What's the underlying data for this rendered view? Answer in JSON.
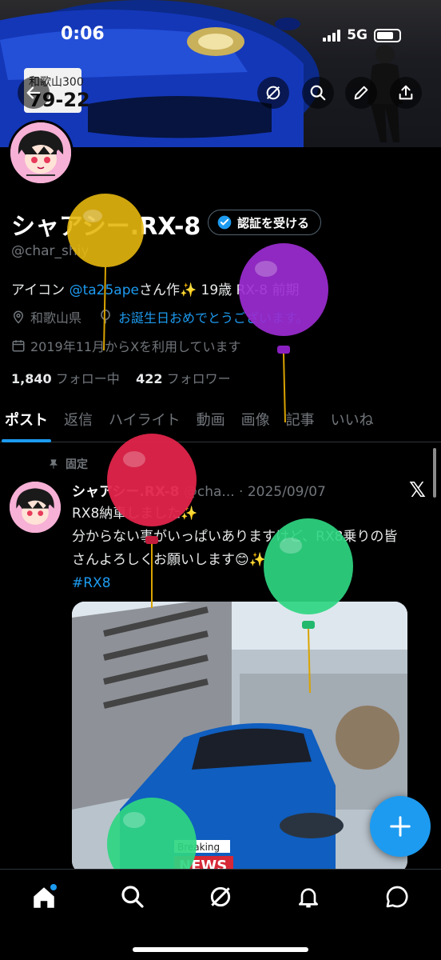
{
  "status_bar": {
    "time": "0:06",
    "network": "5G"
  },
  "profile": {
    "name": "シャアシー.RX-8",
    "verify_label": "認証を受ける",
    "handle": "@char_shiy",
    "bio_prefix": "アイコン ",
    "bio_mention": "@ta25ape",
    "bio_suffix": "さん作✨  19歳 RX-8 前期",
    "location": "和歌山県",
    "birthday_text": "お誕生日おめでとうございます。",
    "joined": "2019年11月からXを利用しています",
    "following_count": "1,840",
    "following_label": "フォロー中",
    "followers_count": "422",
    "followers_label": "フォロワー"
  },
  "tabs": [
    {
      "label": "ポスト"
    },
    {
      "label": "返信"
    },
    {
      "label": "ハイライト"
    },
    {
      "label": "動画"
    },
    {
      "label": "画像"
    },
    {
      "label": "記事"
    },
    {
      "label": "いいね"
    }
  ],
  "post": {
    "pinned_label": "固定",
    "author_name": "シャアシー.RX-8",
    "author_handle_date": "@cha... · 2025/09/07",
    "line1": "RX8納車しました✨",
    "line2": "分からない事がいっぱいありますけど、RX8乗りの皆さんよろしくお願いします😊✨",
    "hashtag": "#RX8",
    "image_overlay_small": "Breaking",
    "image_overlay_big": "NEWS"
  },
  "colors": {
    "accent": "#1d9bf0",
    "balloon_yellow": "#e5b70f",
    "balloon_purple": "#9b2cd1",
    "balloon_red": "#e0244a",
    "balloon_green": "#2fd682"
  },
  "icons": [
    "back-arrow-icon",
    "grok-icon",
    "search-icon",
    "edit-icon",
    "share-icon",
    "verified-icon",
    "location-icon",
    "balloon-icon",
    "calendar-icon",
    "pin-icon",
    "x-logo-icon",
    "plus-icon",
    "home-icon",
    "bell-icon",
    "message-icon"
  ]
}
